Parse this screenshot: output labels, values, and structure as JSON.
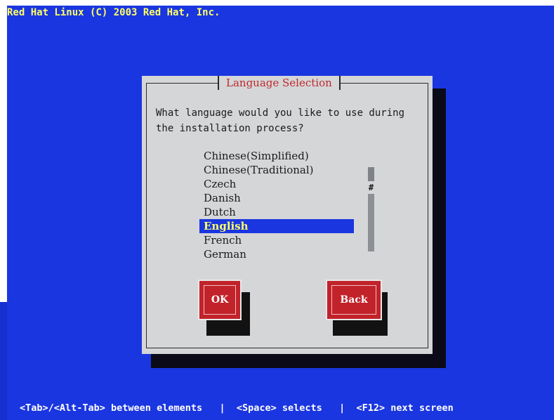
{
  "header": {
    "title": "Red Hat Linux (C) 2003 Red Hat, Inc."
  },
  "dialog": {
    "title": "Language Selection",
    "prompt": "What language would you like to use during the installation process?",
    "languages": [
      "Chinese(Simplified)",
      "Chinese(Traditional)",
      "Czech",
      "Danish",
      "Dutch",
      "English",
      "French",
      "German"
    ],
    "selected_language": "English",
    "scroll_indicator": "#",
    "buttons": {
      "ok": "OK",
      "back": "Back"
    }
  },
  "footer": {
    "help": "<Tab>/<Alt-Tab> between elements   |  <Space> selects   |  <F12> next screen"
  },
  "colors": {
    "screen_background": "#1a36e0",
    "dialog_background": "#d4d6d8",
    "title_text": "#c0282a",
    "selection_highlight": "#1a36e0",
    "selection_text": "#ffff66",
    "button": "#c2222a",
    "header_text": "#ffff66"
  }
}
